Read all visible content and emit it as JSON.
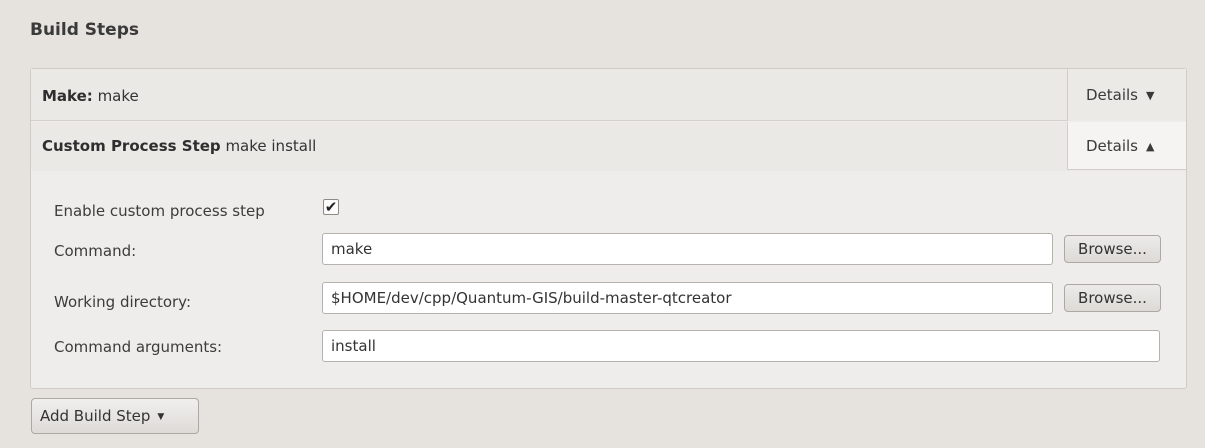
{
  "section": {
    "title": "Build Steps"
  },
  "steps": [
    {
      "title_bold": "Make:",
      "title_rest": " make",
      "details_label": "Details",
      "details_icon": "triangle-down-icon",
      "expanded": false
    },
    {
      "title_bold": "Custom Process Step",
      "title_rest": " make install",
      "details_label": "Details",
      "details_icon": "triangle-up-icon",
      "expanded": true
    }
  ],
  "custom_step": {
    "enable_label": "Enable custom process step",
    "enable_checked": true,
    "check_glyph": "✔",
    "command_label": "Command:",
    "command_value": "make",
    "workdir_label": "Working directory:",
    "workdir_value": "$HOME/dev/cpp/Quantum-GIS/build-master-qtcreator",
    "args_label": "Command arguments:",
    "args_value": "install",
    "browse_label": "Browse..."
  },
  "add_step": {
    "label": "Add Build Step",
    "icon": "dropdown-caret-icon"
  }
}
